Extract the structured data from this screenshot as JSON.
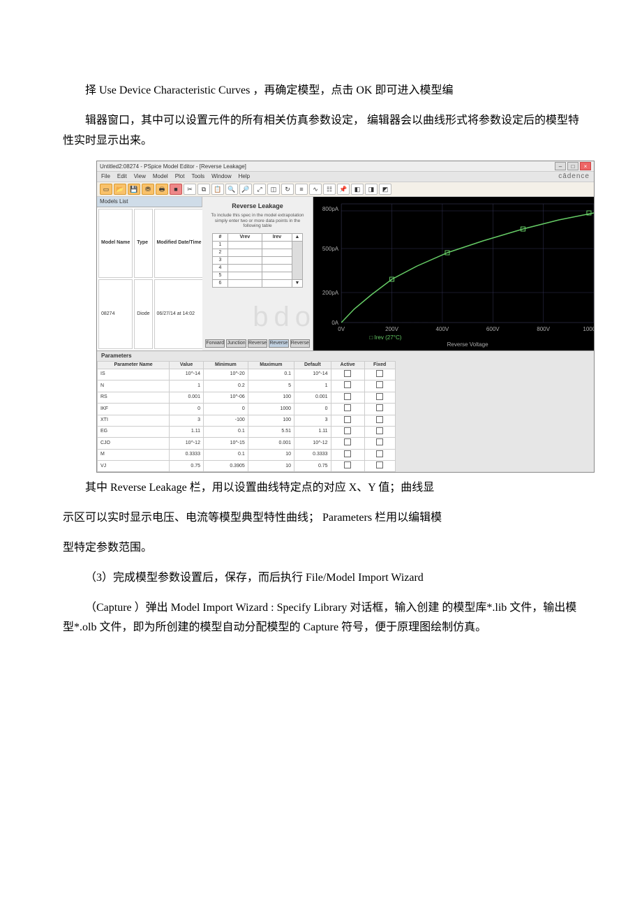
{
  "text": {
    "p1": "择 Use Device Characteristic Curves ，再确定模型，点击 OK 即可进入模型编",
    "p2": "辑器窗口，其中可以设置元件的所有相关仿真参数设定， 编辑器会以曲线形式将参数设定后的模型特性实时显示出来。",
    "p3a": "其中 Reverse Leakage 栏，用以设置曲线特定点的对应 X、Y 值；曲线显",
    "p3b": "示区可以实时显示电压、电流等模型典型特性曲线； Parameters 栏用以编辑模",
    "p3c": "型特定参数范围。",
    "p4": "（3）完成模型参数设置后，保存，而后执行 File/Model Import Wizard",
    "p5": "（Capture ）弹出 Model Import Wizard : Specify Library 对话框，输入创建 的模型库*.lib 文件，输出模型*.olb 文件，即为所创建的模型自动分配模型的 Capture 符号，便于原理图绘制仿真。"
  },
  "watermark": "bdocx.com",
  "app": {
    "title": "Untitled2:08274 - PSpice Model Editor - [Reverse Leakage]",
    "brand": "cādence",
    "menu": [
      "File",
      "Edit",
      "View",
      "Model",
      "Plot",
      "Tools",
      "Window",
      "Help"
    ],
    "modelsList": {
      "header": "Models List",
      "cols": [
        "Model Name",
        "Type",
        "Modified Date/Time"
      ],
      "row": [
        "08274",
        "Diode",
        "06/27/14 at 14:02"
      ]
    },
    "reverseLeakage": {
      "title": "Reverse Leakage",
      "note": "To include this spec in the model extrapolation simply enter two or more data points in the following table",
      "cols": [
        "#",
        "Vrev",
        "Irev"
      ]
    },
    "tabs": [
      "Forward",
      "Junction",
      "Reverse",
      "Reverse",
      "Reverse"
    ],
    "chart": {
      "xlabel": "Reverse Voltage",
      "legend": "Irev (27°C)"
    },
    "params": {
      "title": "Parameters",
      "cols": [
        "Parameter Name",
        "Value",
        "Minimum",
        "Maximum",
        "Default",
        "Active",
        "Fixed"
      ],
      "rows": [
        [
          "IS",
          "10^-14",
          "10^-20",
          "0.1",
          "10^-14"
        ],
        [
          "N",
          "1",
          "0.2",
          "5",
          "1"
        ],
        [
          "RS",
          "0.001",
          "10^-06",
          "100",
          "0.001"
        ],
        [
          "IKF",
          "0",
          "0",
          "1000",
          "0"
        ],
        [
          "XTI",
          "3",
          "-100",
          "100",
          "3"
        ],
        [
          "EG",
          "1.11",
          "0.1",
          "5.51",
          "1.11"
        ],
        [
          "CJO",
          "10^-12",
          "10^-15",
          "0.001",
          "10^-12"
        ],
        [
          "M",
          "0.3333",
          "0.1",
          "10",
          "0.3333"
        ],
        [
          "VJ",
          "0.75",
          "0.3905",
          "10",
          "0.75"
        ]
      ]
    }
  },
  "chart_data": {
    "type": "line",
    "title": "Reverse Leakage",
    "xlabel": "Reverse Voltage",
    "ylabel": "Irev",
    "legend": [
      "Irev (27°C)"
    ],
    "xlim": [
      0,
      1000
    ],
    "xticks": [
      0,
      200,
      400,
      600,
      800,
      1000
    ],
    "ylim_label_top": "800pA",
    "yticks_labels": [
      "0A",
      "200pA",
      "500pA",
      "800pA"
    ],
    "series": [
      {
        "name": "Irev (27°C)",
        "x": [
          0,
          50,
          120,
          200,
          300,
          420,
          560,
          720,
          860,
          1000
        ],
        "y_pA": [
          0,
          90,
          190,
          290,
          380,
          470,
          550,
          630,
          690,
          740
        ]
      }
    ]
  }
}
